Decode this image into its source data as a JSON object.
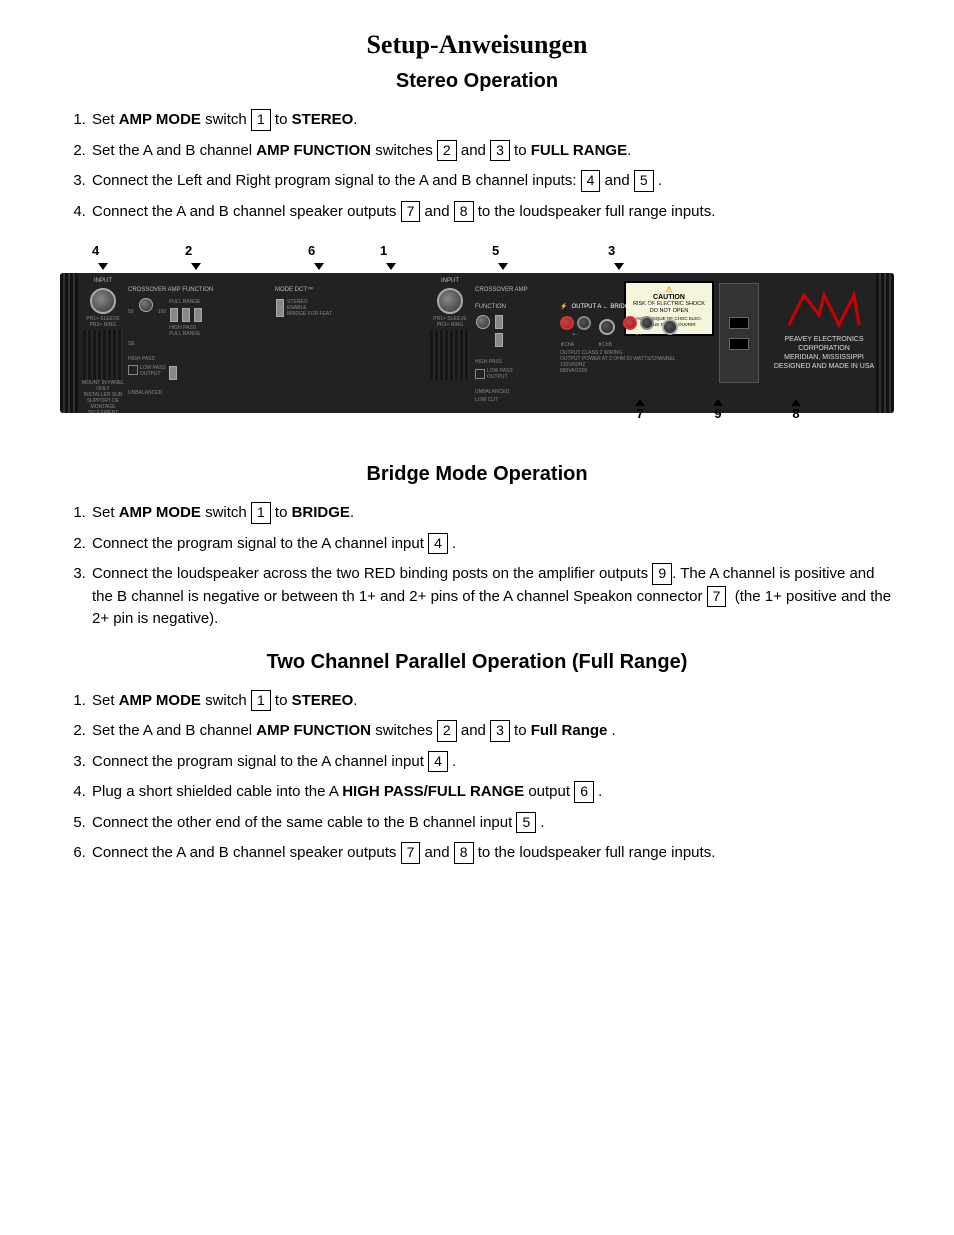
{
  "title": "Setup-Anweisungen",
  "stereo": {
    "heading": "Stereo Operation",
    "steps": [
      {
        "text_before": "Set ",
        "bold1": "AMP MODE",
        "text_mid": " switch ",
        "num1": "1",
        "text_after": " to ",
        "bold2": "STEREO",
        "text_end": "."
      },
      {
        "text_before": "Set the A and B channel ",
        "bold1": "AMP FUNCTION",
        "text_mid": " switches ",
        "num1": "2",
        "text_and": " and ",
        "num2": "3",
        "text_after": " to ",
        "bold2": "FULL RANGE",
        "text_end": "."
      },
      {
        "text_before": "Connect the Left and Right program signal to the A and B channel inputs: ",
        "num1": "4",
        "text_and": " and ",
        "num2": "5",
        "text_end": " ."
      },
      {
        "text_before": "Connect the A and B channel speaker outputs ",
        "num1": "7",
        "text_and": " and ",
        "num2": "8",
        "text_after": " to the loudspeaker full range inputs."
      }
    ]
  },
  "amp_labels_top": [
    "4",
    "2",
    "6",
    "1",
    "5",
    "3"
  ],
  "amp_labels_bottom": [
    "7",
    "9",
    "8"
  ],
  "bridge": {
    "heading": "Bridge Mode Operation",
    "steps": [
      {
        "text_before": "Set ",
        "bold1": "AMP MODE",
        "text_mid": " switch ",
        "num1": "1",
        "text_after": " to ",
        "bold2": "BRIDGE",
        "text_end": "."
      },
      {
        "text_before": "Connect the program signal to the A channel input ",
        "num1": "4",
        "text_end": " ."
      },
      {
        "text_before": "Connect the loudspeaker across the two RED binding posts on the amplifier outputs ",
        "num1": "9",
        "text_mid": ". The A channel is positive and the B channel is negative or between th 1+ and 2+ pins of the A channel Speakon connector ",
        "num2": "7",
        "text_after": "  (the 1+ positive and the 2+ pin is negative)."
      }
    ]
  },
  "parallel": {
    "heading": "Two Channel Parallel Operation (Full Range)",
    "steps": [
      {
        "text_before": "Set ",
        "bold1": "AMP MODE",
        "text_mid": " switch ",
        "num1": "1",
        "text_after": " to ",
        "bold2": "STEREO",
        "text_end": "."
      },
      {
        "text_before": "Set the A and B channel ",
        "bold1": "AMP FUNCTION",
        "text_mid": " switches ",
        "num1": "2",
        "text_and": " and ",
        "num2": "3",
        "text_after": " to ",
        "bold2": "Full Range",
        "text_end": " ."
      },
      {
        "text_before": "Connect the program signal to the A channel input ",
        "num1": "4",
        "text_end": " ."
      },
      {
        "text_before": "Plug a short shielded cable into the A ",
        "bold1": "HIGH PASS/FULL RANGE",
        "text_mid": " output ",
        "num1": "6",
        "text_end": " ."
      },
      {
        "text_before": "Connect the other end of the same cable to the B channel input ",
        "num1": "5",
        "text_end": " ."
      },
      {
        "text_before": "Connect the A and B channel speaker outputs ",
        "num1": "7",
        "text_and": " and ",
        "num2": "8",
        "text_after": " to the loudspeaker full range inputs."
      }
    ]
  }
}
